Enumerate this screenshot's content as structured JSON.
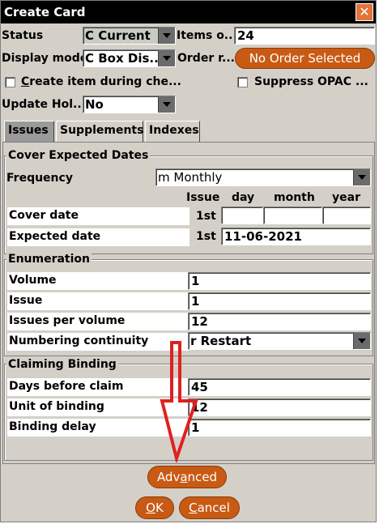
{
  "title": "Create Card",
  "top": {
    "status_label": "Status",
    "status_value": "C Current",
    "items_label": "Items o...",
    "items_value": "24",
    "display_label": "Display mode",
    "display_value": "C Box Dis...",
    "order_label": "Order r...",
    "order_button": "No Order Selected",
    "create_item_label_pre": "C",
    "create_item_label_rest": "reate item during che...",
    "suppress_label": "Suppress OPAC ...",
    "update_label": "Update Hol...",
    "update_value": "No"
  },
  "tabs": [
    "Issues",
    "Supplements",
    "Indexes"
  ],
  "cover": {
    "title": "Cover  Expected Dates",
    "frequency_label": "Frequency",
    "frequency_value": "m Monthly",
    "col_issue": "Issue",
    "col_day": "day",
    "col_month": "month",
    "col_year": "year",
    "cover_date_label": "Cover date",
    "cover_date_issue": "1st",
    "expected_date_label": "Expected date",
    "expected_date_issue": "1st",
    "expected_date_value": "11-06-2021"
  },
  "enumeration": {
    "title": "Enumeration",
    "volume_label": "Volume",
    "volume_value": "1",
    "issue_label": "Issue",
    "issue_value": "1",
    "ipv_label": "Issues per volume",
    "ipv_value": "12",
    "continuity_label": "Numbering continuity",
    "continuity_value": "r Restart"
  },
  "claiming": {
    "title": "Claiming  Binding",
    "days_label": "Days before claim",
    "days_value": "45",
    "unit_label": "Unit of binding",
    "unit_value": "12",
    "delay_label": "Binding delay",
    "delay_value": "1"
  },
  "buttons": {
    "advanced_pre": "Adv",
    "advanced_ul": "a",
    "advanced_post": "nced",
    "ok_ul": "O",
    "ok_post": "K",
    "cancel_ul": "C",
    "cancel_post": "ancel"
  },
  "colors": {
    "accent": "#c85a14",
    "annotation_arrow": "#e02020"
  }
}
